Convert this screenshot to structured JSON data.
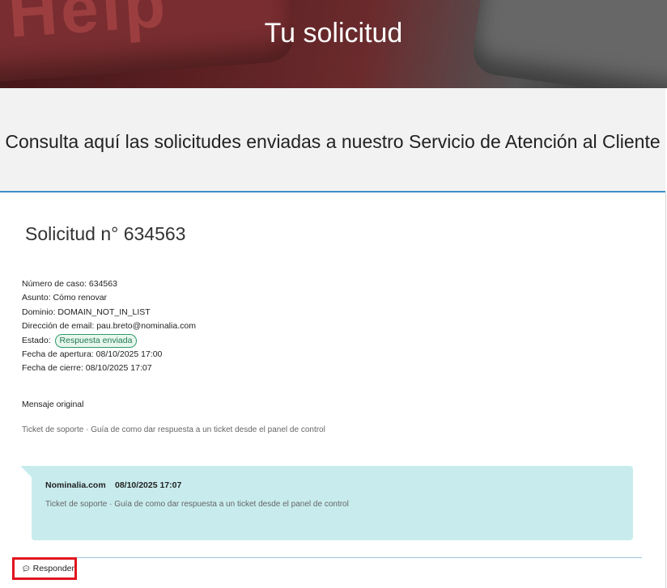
{
  "header": {
    "title": "Tu solicitud",
    "image_text": "Help"
  },
  "intro": {
    "text": "Consulta aquí las solicitudes enviadas a nuestro Servicio de Atención al Cliente"
  },
  "request": {
    "title": "Solicitud n° 634563",
    "details": [
      {
        "label": "Número de caso:",
        "value": "634563"
      },
      {
        "label": "Asunto:",
        "value": "Cómo renovar"
      },
      {
        "label": "Dominio:",
        "value": "DOMAIN_NOT_IN_LIST"
      },
      {
        "label": "Dirección de email:",
        "value": "pau.breto@nominalia.com"
      }
    ],
    "status": {
      "label": "Estado:",
      "value": "Respuesta enviada",
      "color": "#2e9a6a"
    },
    "dates": [
      {
        "label": "Fecha de apertura:",
        "value": "08/10/2025 17:00"
      },
      {
        "label": "Fecha de cierre:",
        "value": "08/10/2025 17:07"
      }
    ],
    "original_label": "Mensaje original",
    "original_message": "Ticket de soporte · Guía de como dar respuesta a un ticket desde el panel de control"
  },
  "reply": {
    "sender": "Nominalia.com",
    "date": "08/10/2025 17:07",
    "message": "Ticket de soporte · Guía de como dar respuesta a un ticket desde el panel de control",
    "bubble_color": "#c8ecee"
  },
  "actions": {
    "reply_label": "Responder",
    "reply_icon": "chat-icon",
    "highlight_color": "#e0141e"
  }
}
